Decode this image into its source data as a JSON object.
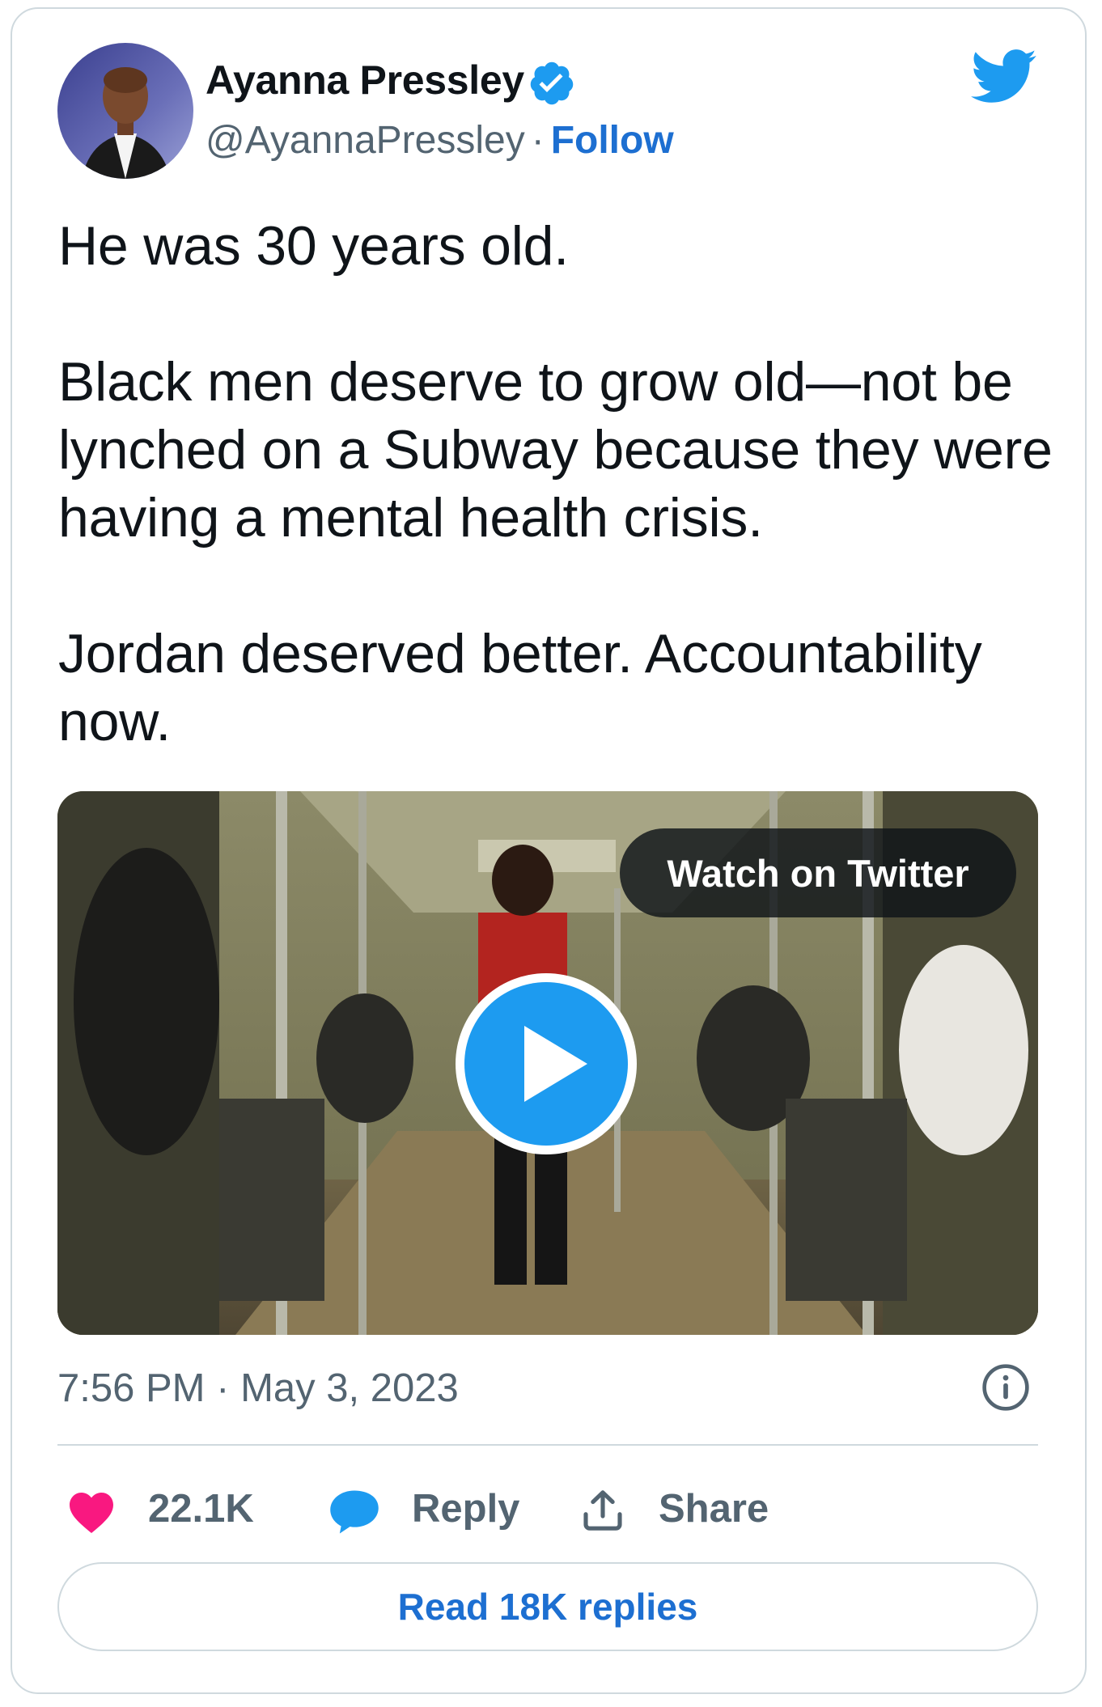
{
  "author": {
    "name": "Ayanna Pressley",
    "handle": "@AyannaPressley",
    "separator": "·",
    "follow_label": "Follow",
    "verified": true
  },
  "platform_icon": "twitter-bird-icon",
  "tweet": {
    "paragraphs": [
      "He was 30 years old.",
      "Black men deserve to grow old—not be lynched on a Subway because they were having a mental health crisis.",
      "Jordan deserved better. Accountability now."
    ]
  },
  "media": {
    "watch_label": "Watch on Twitter",
    "play_icon": "play-icon"
  },
  "meta": {
    "time": "7:56 PM",
    "separator": "·",
    "date": "May 3, 2023",
    "info_icon": "info-icon"
  },
  "actions": {
    "likes": "22.1K",
    "reply_label": "Reply",
    "share_label": "Share"
  },
  "read_replies_label": "Read 18K replies",
  "colors": {
    "accent": "#1d9bf0",
    "link": "#1d6fd1",
    "like": "#f91880",
    "text": "#0f1419",
    "muted": "#536471",
    "border": "#cfd9de"
  }
}
